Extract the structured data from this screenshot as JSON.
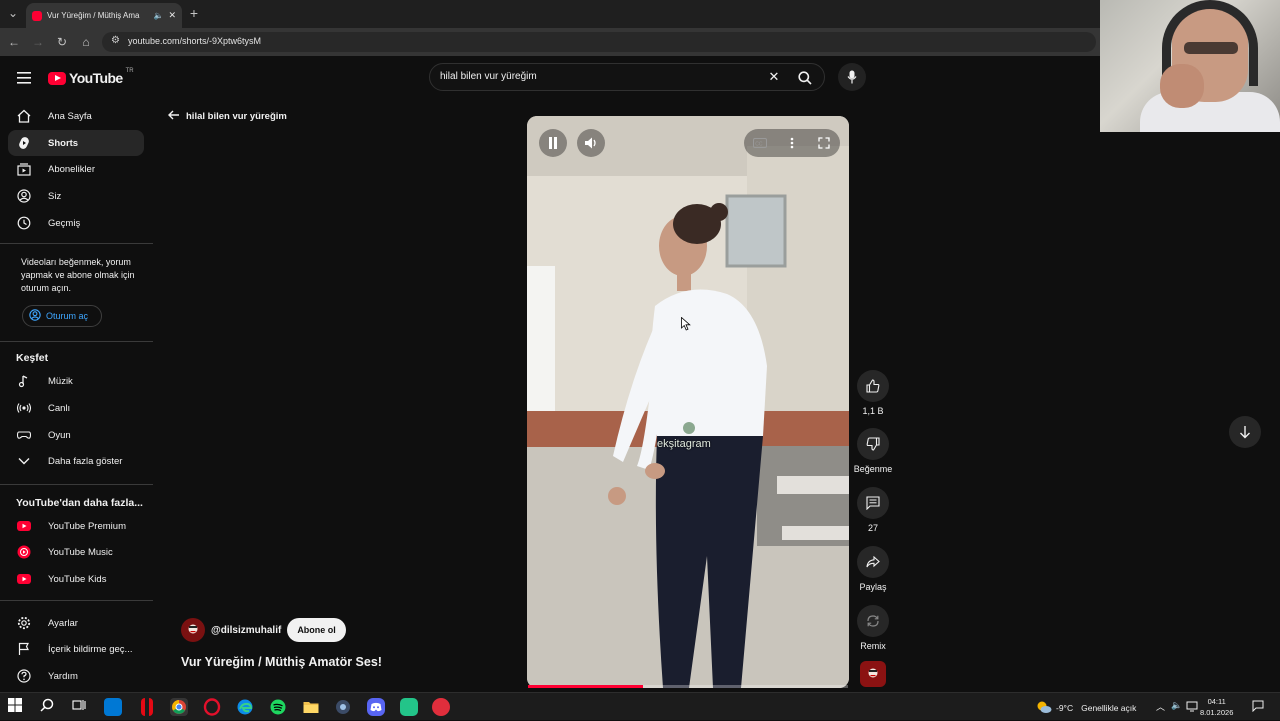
{
  "browser": {
    "tab_title": "Vur Yüreğim / Müthiş Ama",
    "url": "youtube.com/shorts/-9Xptw6tysM"
  },
  "masthead": {
    "logo_text": "YouTube",
    "country_code": "TR",
    "search_value": "hilal bilen vur yüreğim"
  },
  "sidebar": {
    "items": [
      {
        "label": "Ana Sayfa",
        "icon": "home-icon"
      },
      {
        "label": "Shorts",
        "icon": "shorts-icon"
      },
      {
        "label": "Abonelikler",
        "icon": "subscriptions-icon"
      },
      {
        "label": "Siz",
        "icon": "you-icon"
      },
      {
        "label": "Geçmiş",
        "icon": "history-icon"
      }
    ],
    "signin_prompt": "Videoları beğenmek, yorum yapmak ve abone olmak için oturum açın.",
    "signin_label": "Oturum aç",
    "explore_heading": "Keşfet",
    "explore": [
      {
        "label": "Müzik",
        "icon": "music-icon"
      },
      {
        "label": "Canlı",
        "icon": "live-icon"
      },
      {
        "label": "Oyun",
        "icon": "gaming-icon"
      },
      {
        "label": "Daha fazla göster",
        "icon": "chevron-down-icon"
      }
    ],
    "more_heading": "YouTube'dan daha fazla...",
    "more": [
      {
        "label": "YouTube Premium"
      },
      {
        "label": "YouTube Music"
      },
      {
        "label": "YouTube Kids"
      }
    ],
    "bottom": [
      {
        "label": "Ayarlar",
        "icon": "settings-icon"
      },
      {
        "label": "İçerik bildirme geç...",
        "icon": "flag-icon"
      },
      {
        "label": "Yardım",
        "icon": "help-icon"
      }
    ]
  },
  "short": {
    "back_label": "hilal bilen vur yüreğim",
    "watermark": "ekşitagram",
    "progress": 0.36,
    "channel": "@dilsizmuhalif",
    "subscribe_label": "Abone ol",
    "title": "Vur Yüreğim / Müthiş Amatör Ses!",
    "actions": {
      "like_count": "1,1 B",
      "dislike_label": "Beğenme",
      "comment_count": "27",
      "share_label": "Paylaş",
      "remix_label": "Remix"
    }
  },
  "taskbar": {
    "weather": "-9°C",
    "weather_text": "Genellikle açık",
    "time": "04:11",
    "date": "8.01.2026"
  },
  "colors": {
    "background": "#0f0f0f",
    "accent_red": "#ff0033",
    "link_blue": "#3ea6ff"
  }
}
